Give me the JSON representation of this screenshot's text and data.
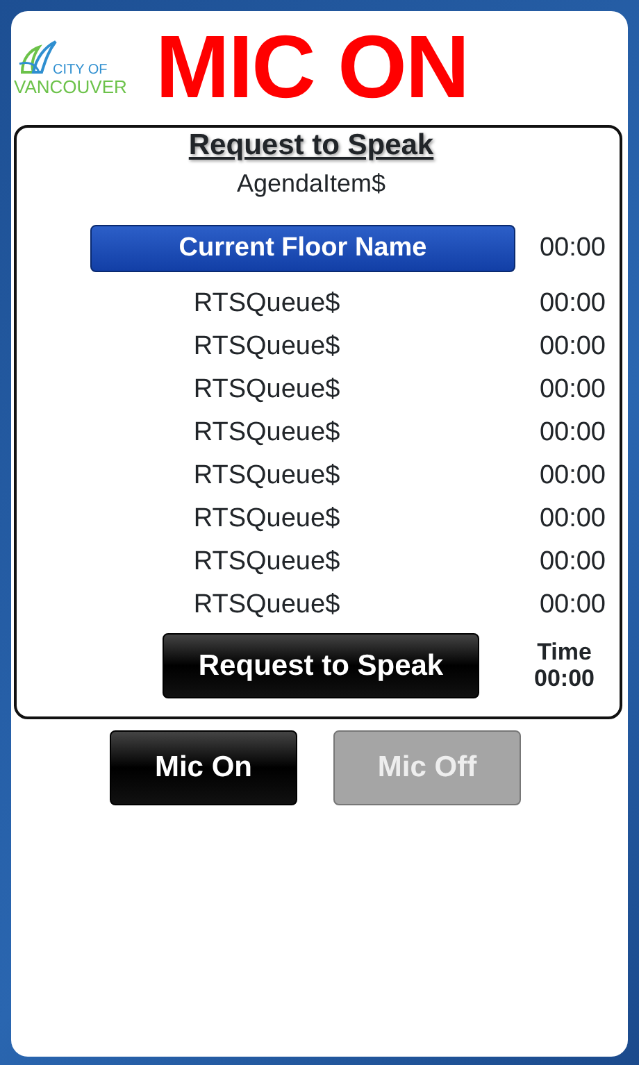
{
  "logo": {
    "line_1": "CITY OF",
    "line_2": "VANCOUVER"
  },
  "status_title": "MIC ON",
  "panel": {
    "heading": "Request to Speak",
    "agenda_item": "AgendaItem$",
    "current_floor": {
      "name": "Current Floor Name",
      "time": "00:00"
    },
    "queue": [
      {
        "name": "RTSQueue$",
        "time": "00:00"
      },
      {
        "name": "RTSQueue$",
        "time": "00:00"
      },
      {
        "name": "RTSQueue$",
        "time": "00:00"
      },
      {
        "name": "RTSQueue$",
        "time": "00:00"
      },
      {
        "name": "RTSQueue$",
        "time": "00:00"
      },
      {
        "name": "RTSQueue$",
        "time": "00:00"
      },
      {
        "name": "RTSQueue$",
        "time": "00:00"
      },
      {
        "name": "RTSQueue$",
        "time": "00:00"
      }
    ],
    "request_button": "Request to Speak",
    "timer_label": "Time",
    "timer_value": "00:00"
  },
  "mic_buttons": [
    {
      "label": "Mic On",
      "disabled": false
    },
    {
      "label": "Mic Off",
      "disabled": true
    }
  ]
}
